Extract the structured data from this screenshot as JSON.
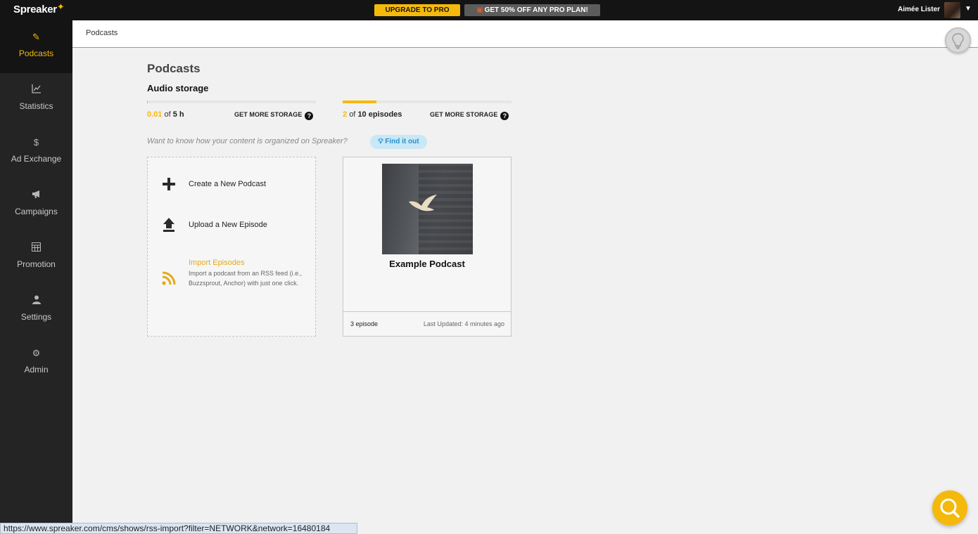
{
  "app": {
    "name": "Spreaker"
  },
  "topbar": {
    "upgrade_label": "UPGRADE TO PRO",
    "promo_label": "GET 50% OFF ANY PRO PLAN!",
    "username": "Aimée Lister"
  },
  "sidebar": {
    "items": [
      {
        "label": "Podcasts",
        "icon": "pencil-icon"
      },
      {
        "label": "Statistics",
        "icon": "chart-icon"
      },
      {
        "label": "Ad Exchange",
        "icon": "dollar-icon"
      },
      {
        "label": "Campaigns",
        "icon": "megaphone-icon"
      },
      {
        "label": "Promotion",
        "icon": "grid-icon"
      },
      {
        "label": "Settings",
        "icon": "user-icon"
      },
      {
        "label": "Admin",
        "icon": "gear-icon"
      }
    ]
  },
  "header": {
    "breadcrumb": "Podcasts"
  },
  "main": {
    "title": "Podcasts",
    "storage_title": "Audio storage",
    "audio_storage": {
      "used": "0.01",
      "of_label": "of",
      "total": "5 h",
      "used_fraction": 0.002,
      "more_label": "GET MORE STORAGE"
    },
    "episode_storage": {
      "used": "2",
      "of_label": "of",
      "total": "10 episodes",
      "used_fraction": 0.2,
      "more_label": "GET MORE STORAGE"
    },
    "hint_text": "Want to know how your content is organized on Spreaker?",
    "find_out_label": "Find it out",
    "actions": {
      "create_label": "Create a New Podcast",
      "upload_label": "Upload a New Episode",
      "import_title": "Import Episodes",
      "import_desc": "Import a podcast from an RSS feed (i.e., Buzzsprout, Anchor) with just one click."
    },
    "podcast_card": {
      "title": "Example Podcast",
      "episodes": "3 episode",
      "updated": "Last Updated: 4 minutes ago"
    }
  },
  "status_url": "https://www.spreaker.com/cms/shows/rss-import?filter=NETWORK&network=16480184",
  "colors": {
    "accent": "#f5b90c",
    "sidebar": "#242424",
    "topbar": "#141414"
  }
}
